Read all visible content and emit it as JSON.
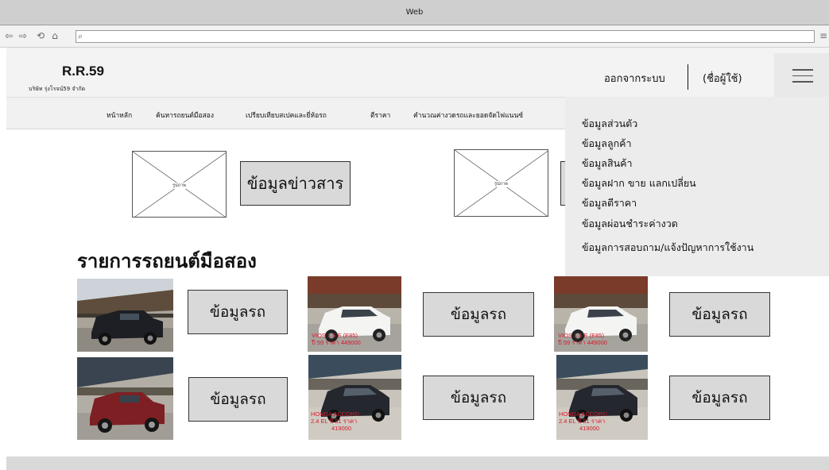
{
  "window": {
    "title": "Web"
  },
  "browser": {
    "back_icon": "⇦",
    "forward_icon": "⇨",
    "refresh_icon": "⟲",
    "home_icon": "⌂",
    "search_icon": "⌕",
    "menu_icon": "≡",
    "url": ""
  },
  "brand": {
    "name": "R.R.59",
    "subtitle": "บริษัท รุ่งโรจน์59 จำกัด"
  },
  "user": {
    "logout": "ออกจากระบบ",
    "name": "(ชื่อผู้ใช้)"
  },
  "nav": {
    "items": [
      "หน้าหลัก",
      "ค้นหารถยนต์มือสอง",
      "เปรียบเทียบสเปคและยี่ห้อรถ",
      "ตีราคา",
      "คำนวณค่างวดรถและยอดจัดไฟแนนซ์"
    ]
  },
  "dropdown": {
    "items": [
      "ข้อมูลส่วนตัว",
      "ข้อมูลลูกค้า",
      "ข้อมูลสินค้า",
      "ข้อมูลฝาก ขาย แลกเปลี่ยน",
      "ข้อมูลตีราคา",
      "ข้อมูลผ่อนชำระค่างวด",
      "ข้อมูลการสอบถาม/แจ้งปัญหาการใช้งาน"
    ]
  },
  "news": {
    "image_label": "รูปภาพ",
    "button": "ข้อมูลข่าวสาร"
  },
  "section": {
    "title": "รายการรถยนต์มือสอง"
  },
  "cars": {
    "button": "ข้อมูลรถ",
    "captions": {
      "vios": [
        "VIOS 1.5 E (E85)",
        "ปี 59 ราคา 449000"
      ],
      "honda": [
        "HONDA ACCORD",
        "2.4 EL ปี 51 ราคา",
        "419000"
      ]
    }
  },
  "colors": {
    "caption_red": "#d41a2b",
    "button_gray": "#d9d9d9",
    "dropdown_bg": "#ececec"
  }
}
